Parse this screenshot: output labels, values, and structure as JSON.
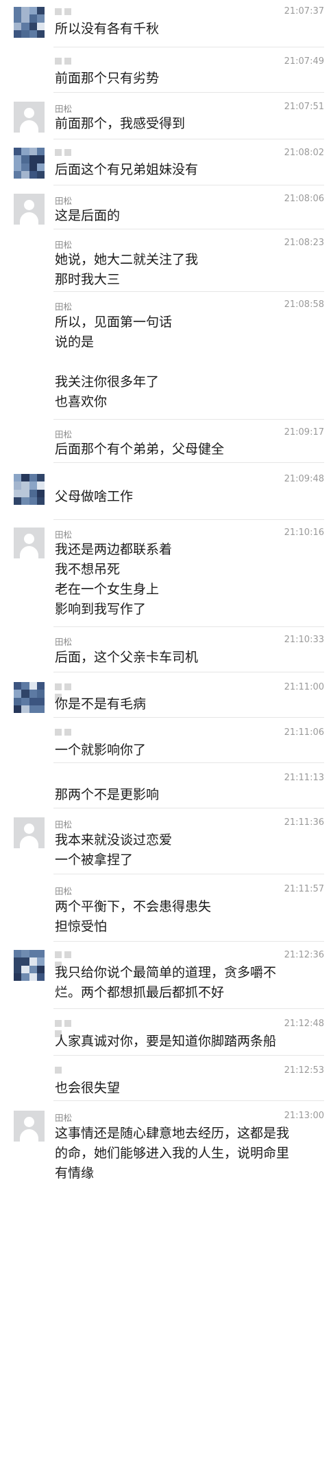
{
  "messages": [
    {
      "avatar": "mosaic",
      "name": "",
      "time": "21:07:37",
      "text": "所以没有各有千秋"
    },
    {
      "avatar": "none",
      "name": "",
      "time": "21:07:49",
      "text": "前面那个只有劣势"
    },
    {
      "avatar": "gray",
      "name": "田松",
      "time": "21:07:51",
      "text": "前面那个，我感受得到"
    },
    {
      "avatar": "mosaic",
      "name": "",
      "time": "21:08:02",
      "text": "后面这个有兄弟姐妹没有"
    },
    {
      "avatar": "gray",
      "name": "田松",
      "time": "21:08:06",
      "text": "这是后面的"
    },
    {
      "avatar": "none",
      "name": "田松",
      "time": "21:08:23",
      "text": "她说，她大二就关注了我\n那时我大三"
    },
    {
      "avatar": "none",
      "name": "田松",
      "time": "21:08:58",
      "text": "所以，见面第一句话\n说的是\n\n我关注你很多年了\n也喜欢你"
    },
    {
      "avatar": "none",
      "name": "田松",
      "time": "21:09:17",
      "text": "后面那个有个弟弟，父母健全"
    },
    {
      "avatar": "mosaic",
      "name": "",
      "time": "21:09:48",
      "text": "父母做啥工作"
    },
    {
      "avatar": "gray",
      "name": "田松",
      "time": "21:10:16",
      "text": "我还是两边都联系着\n我不想吊死\n老在一个女生身上\n影响到我写作了"
    },
    {
      "avatar": "none",
      "name": "田松",
      "time": "21:10:33",
      "text": "后面，这个父亲卡车司机"
    },
    {
      "avatar": "mosaic",
      "name": "",
      "time": "21:11:00",
      "text": "你是不是有毛病"
    },
    {
      "avatar": "none",
      "name": "",
      "time": "21:11:06",
      "text": "一个就影响你了"
    },
    {
      "avatar": "none",
      "name": "",
      "time": "21:11:13",
      "text": "那两个不是更影响"
    },
    {
      "avatar": "gray",
      "name": "田松",
      "time": "21:11:36",
      "text": "我本来就没谈过恋爱\n一个被拿捏了"
    },
    {
      "avatar": "none",
      "name": "田松",
      "time": "21:11:57",
      "text": "两个平衡下，不会患得患失\n担惊受怕"
    },
    {
      "avatar": "mosaic",
      "name": "",
      "time": "21:12:36",
      "text": "我只给你说个最简单的道理，贪多嚼不\n烂。两个都想抓最后都抓不好"
    },
    {
      "avatar": "none",
      "name": "",
      "time": "21:12:48",
      "text": "人家真诚对你，要是知道你脚踏两条船"
    },
    {
      "avatar": "none",
      "name": "",
      "time": "21:12:53",
      "text": "也会很失望"
    },
    {
      "avatar": "gray",
      "name": "田松",
      "time": "21:13:00",
      "text": "这事情还是随心肆意地去经历，这都是我\n的命，她们能够进入我的人生，说明命里\n有情缘"
    }
  ]
}
